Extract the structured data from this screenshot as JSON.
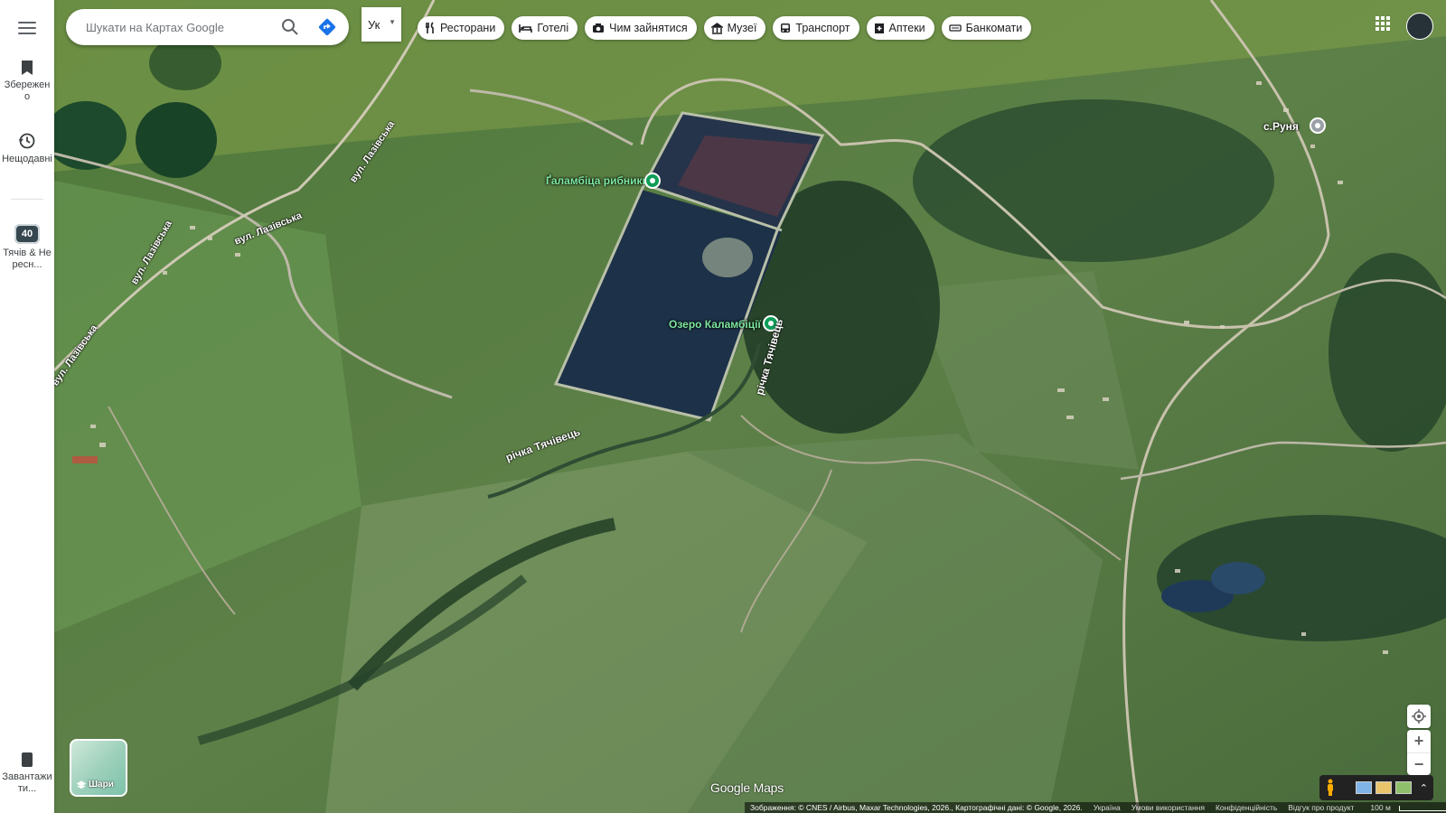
{
  "search": {
    "placeholder": "Шукати на Картах Google"
  },
  "lang": {
    "label": "Ук"
  },
  "chips": [
    {
      "icon": "restaurant-icon",
      "label": "Ресторани"
    },
    {
      "icon": "hotel-icon",
      "label": "Готелі"
    },
    {
      "icon": "camera-icon",
      "label": "Чим зайнятися"
    },
    {
      "icon": "museum-icon",
      "label": "Музеї"
    },
    {
      "icon": "bus-icon",
      "label": "Транспорт"
    },
    {
      "icon": "pharmacy-icon",
      "label": "Аптеки"
    },
    {
      "icon": "atm-icon",
      "label": "Банкомати"
    }
  ],
  "rail": {
    "saved": "Збережено",
    "recent": "Нещодавні",
    "recent_badge": "40",
    "recent_place": "Тячів & Нересн...",
    "download": "Завантажити..."
  },
  "layers": {
    "label": "Шари"
  },
  "places": {
    "fishery": "Ґаламбіца рибники",
    "lake": "Озеро Каламбіції",
    "village": "с.Руня",
    "river1": "річка Тячівець",
    "river2": "річка Тячівець",
    "street": "вул. Лазівська"
  },
  "logo": "Google Maps",
  "footer": {
    "attribution": "Зображення: © CNES / Airbus, Maxar Technologies, 2026., Картографічні дані: © Google, 2026.",
    "country": "Україна",
    "terms": "Умови використання",
    "privacy": "Конфіденційність",
    "feedback": "Відгук про продукт",
    "scale": "100 м"
  },
  "colors": {
    "fishery_pin": "#0f9d58",
    "lake_pin": "#0f9d58",
    "village_pin": "#9aa0a6"
  }
}
